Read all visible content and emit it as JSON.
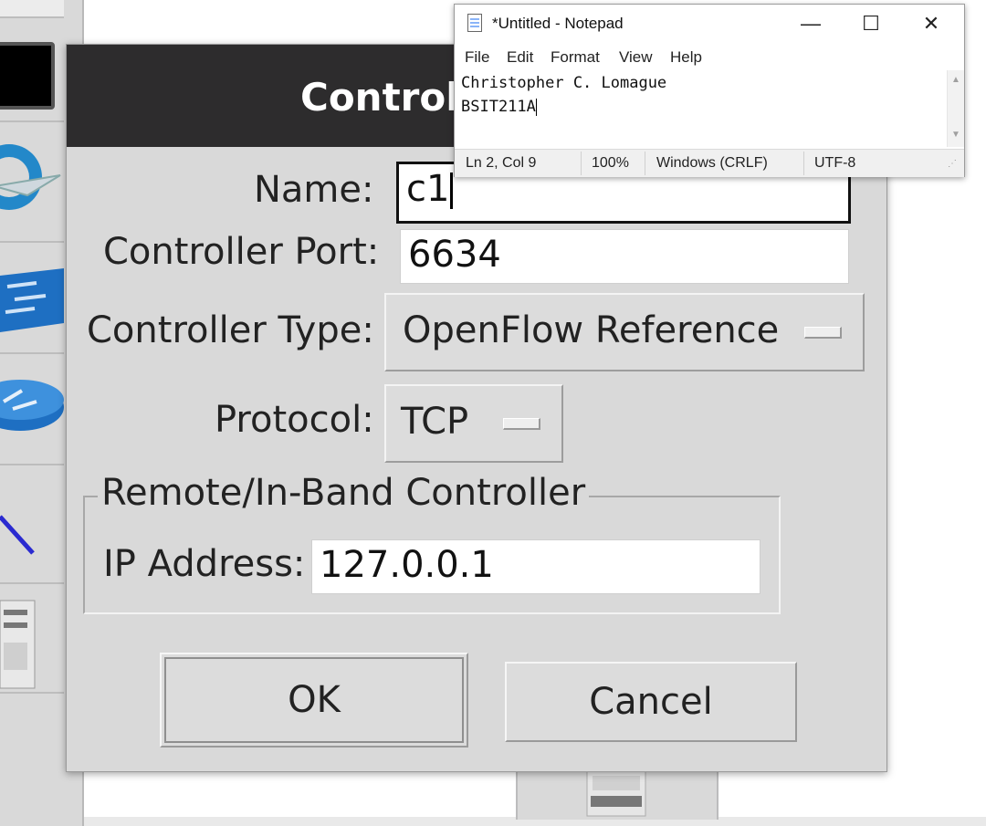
{
  "dialog": {
    "title": "Controll",
    "name_label": "Name:",
    "name_value": "c1",
    "port_label": "Controller Port:",
    "port_value": "6634",
    "type_label": "Controller Type:",
    "type_value": "OpenFlow Reference",
    "protocol_label": "Protocol:",
    "protocol_value": "TCP",
    "group_label": "Remote/In-Band Controller",
    "ip_label": "IP Address:",
    "ip_value": "127.0.0.1",
    "ok_label": "OK",
    "cancel_label": "Cancel"
  },
  "notepad": {
    "title": "*Untitled - Notepad",
    "menu": [
      "File",
      "Edit",
      "Format",
      "View",
      "Help"
    ],
    "lines": [
      "Christopher C. Lomague",
      "BSIT211A"
    ],
    "status": {
      "position": "Ln 2, Col 9",
      "zoom": "100%",
      "line_endings": "Windows (CRLF)",
      "encoding": "UTF-8"
    },
    "controls": {
      "minimize": "—",
      "maximize": "☐",
      "close": "✕"
    }
  },
  "colors": {
    "titlebar": "#2d2c2d",
    "dialog_bg": "#d9d9d9",
    "switch_blue": "#1e6fc2",
    "link_line": "#2a2ad0"
  },
  "icons": [
    "controller-icon",
    "switch-icon",
    "router-icon",
    "netlink-icon",
    "host-icon"
  ]
}
